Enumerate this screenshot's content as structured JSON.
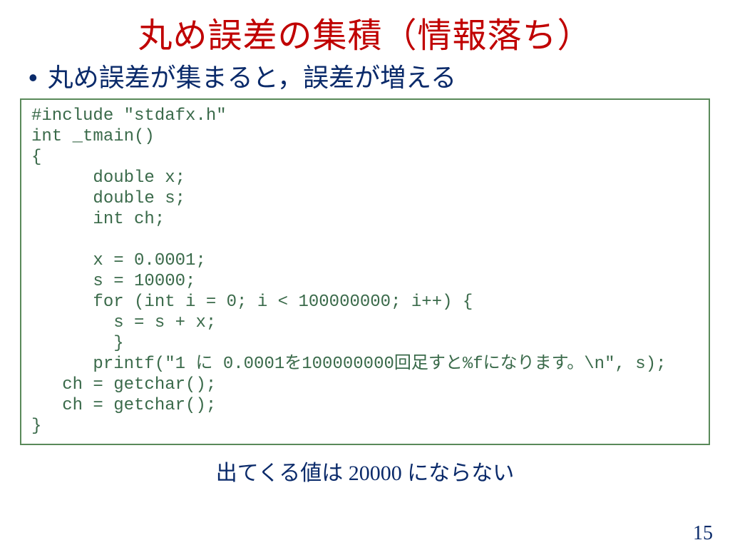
{
  "title": "丸め誤差の集積（情報落ち）",
  "bullet": {
    "dot": "•",
    "text": "丸め誤差が集まると，誤差が増える"
  },
  "code": {
    "l01": "#include \"stdafx.h\"",
    "l02": "int _tmain()",
    "l03": "{",
    "l04": "      double x;",
    "l05": "      double s;",
    "l06": "      int ch;",
    "l07": "",
    "l08": "      x = 0.0001;",
    "l09": "      s = 10000;",
    "l10": "      for (int i = 0; i < 100000000; i++) {",
    "l11": "        s = s + x;",
    "l12": "        }",
    "l13": "      printf(\"1 に 0.0001を100000000回足すと%fになります。\\n\", s);",
    "l14": "   ch = getchar();",
    "l15": "   ch = getchar();",
    "l16": "}"
  },
  "footnote": "出てくる値は 20000 にならない",
  "page_number": "15"
}
